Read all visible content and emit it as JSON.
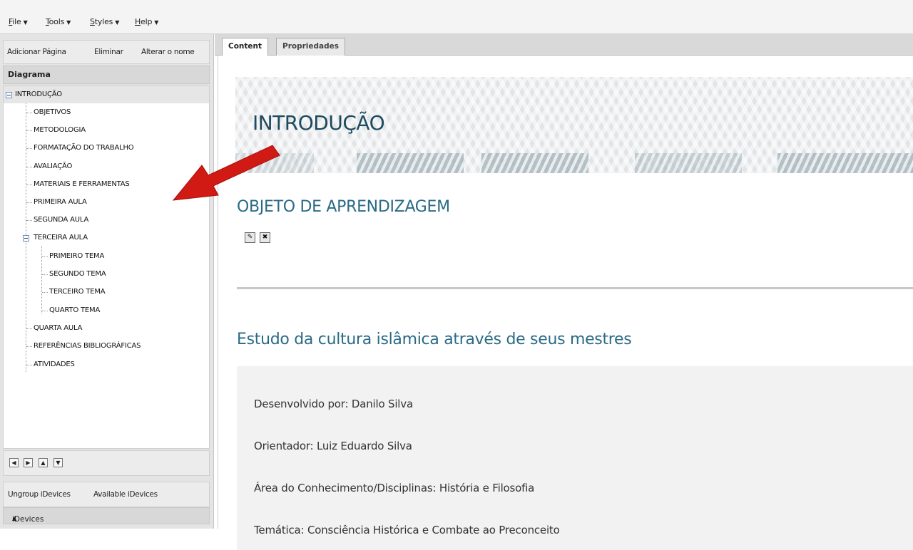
{
  "menubar": {
    "items": [
      {
        "u": "F",
        "rest": "ile"
      },
      {
        "u": "T",
        "rest": "ools"
      },
      {
        "u": "S",
        "rest": "tyles"
      },
      {
        "u": "H",
        "rest": "elp"
      }
    ]
  },
  "left_toolbar": {
    "add_page": "Adicionar Página",
    "delete": "Eliminar",
    "rename": "Alterar o nome"
  },
  "diagram": {
    "title": "Diagrama",
    "root": "INTRODUÇÃO",
    "children": [
      "OBJETIVOS",
      "METODOLOGIA",
      "FORMATAÇÃO DO TRABALHO",
      "AVALIAÇÃO",
      "MATERIAIS E FERRAMENTAS",
      "PRIMEIRA AULA",
      "SEGUNDA AULA",
      "TERCEIRA AULA",
      "PRIMEIRO TEMA",
      "SEGUNDO TEMA",
      "TERCEIRO TEMA",
      "QUARTO TEMA",
      "QUARTA AULA",
      "REFERÊNCIAS BIBLIOGRÁFICAS",
      "ATIVIDADES"
    ]
  },
  "nav_buttons": [
    "move-left-icon",
    "move-right-icon",
    "move-up-icon",
    "move-down-icon"
  ],
  "idevices": {
    "ungroup": "Ungroup iDevices",
    "available": "Available iDevices",
    "panel_title": "iDevices"
  },
  "tabs": {
    "content": "Content",
    "properties": "Propriedades"
  },
  "page": {
    "title": "INTRODUÇÃO",
    "object_title": "OBJETO DE APRENDIZAGEM",
    "subtitle": "Estudo da cultura islâmica através de seus mestres",
    "lines": [
      "Desenvolvido por: Danilo Silva",
      "Orientador: Luiz Eduardo Silva",
      "Área do Conhecimento/Disciplinas: História e Filosofia",
      "Temática: Consciência Histórica e Combate ao Preconceito"
    ]
  },
  "colors": {
    "title": "#1d4a5e",
    "heading": "#2a6a85",
    "arrow": "#d11a14"
  }
}
